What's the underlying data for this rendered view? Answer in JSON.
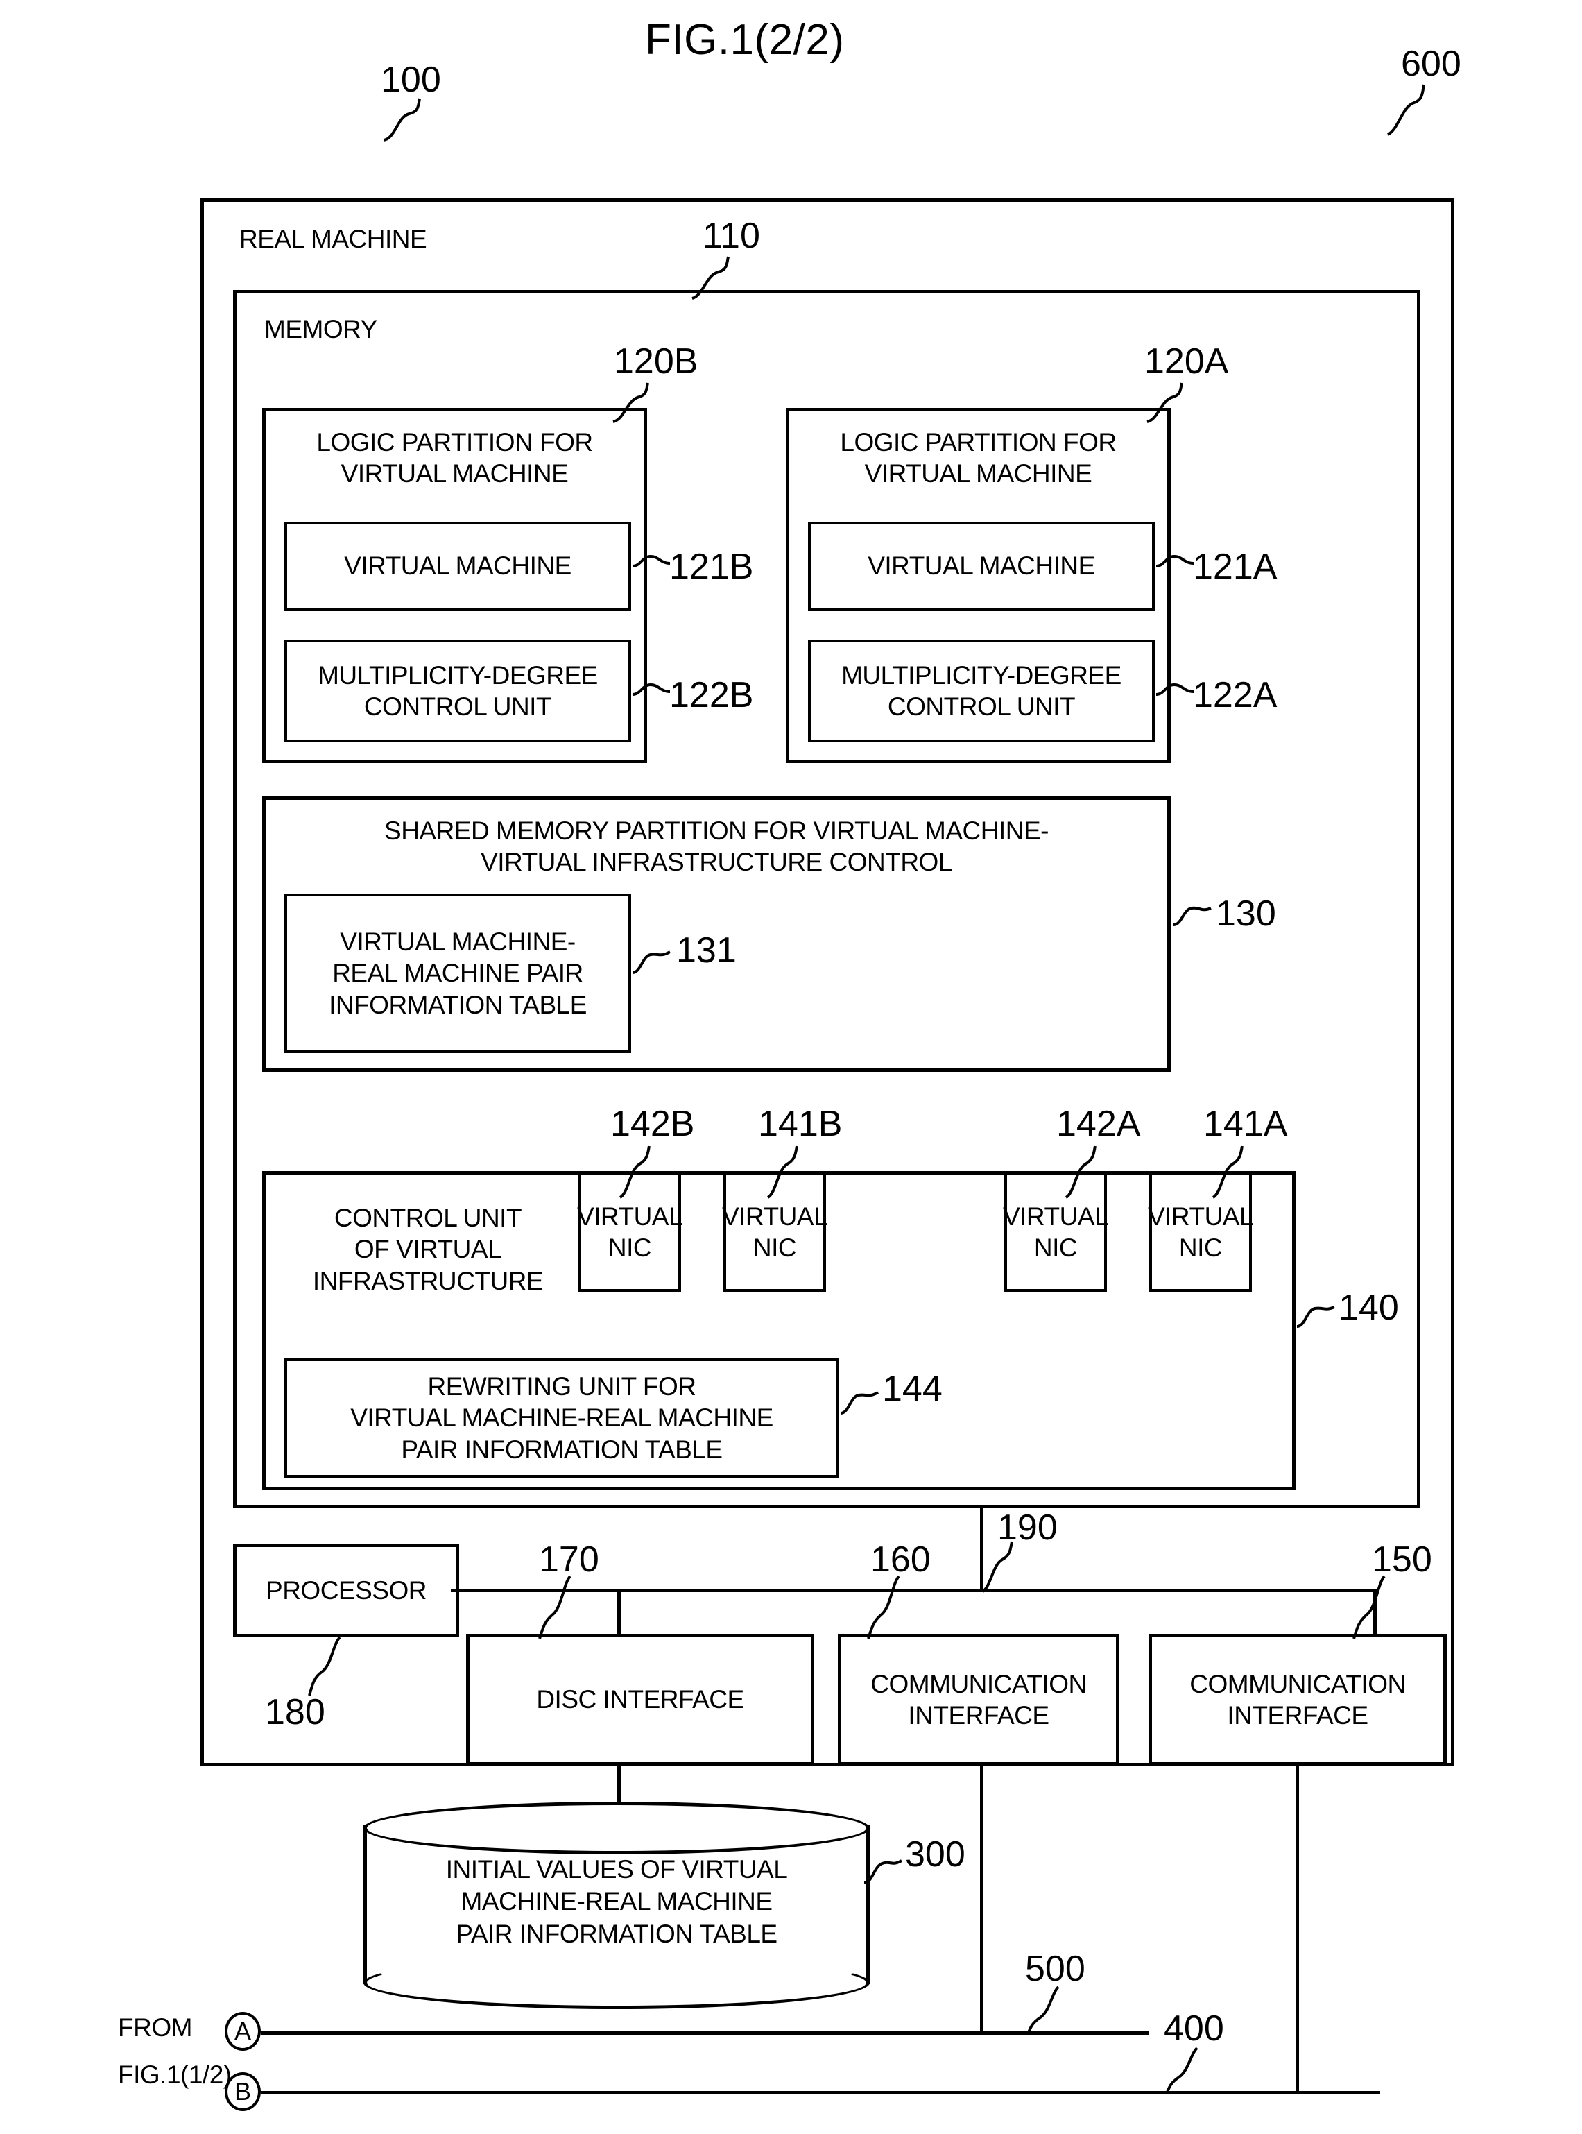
{
  "figure": {
    "title": "FIG.1(2/2)"
  },
  "outer": {
    "label": "REAL MACHINE",
    "ref_real_machine": "100",
    "ref_system": "600"
  },
  "memory": {
    "label": "MEMORY",
    "ref": "110"
  },
  "partitions": [
    {
      "ref": "120B",
      "title_line1": "LOGIC PARTITION FOR",
      "title_line2": "VIRTUAL MACHINE",
      "vm_label": "VIRTUAL MACHINE",
      "vm_ref": "121B",
      "mdcu_line1": "MULTIPLICITY-DEGREE",
      "mdcu_line2": "CONTROL UNIT",
      "mdcu_ref": "122B"
    },
    {
      "ref": "120A",
      "title_line1": "LOGIC PARTITION FOR",
      "title_line2": "VIRTUAL MACHINE",
      "vm_label": "VIRTUAL MACHINE",
      "vm_ref": "121A",
      "mdcu_line1": "MULTIPLICITY-DEGREE",
      "mdcu_line2": "CONTROL UNIT",
      "mdcu_ref": "122A"
    }
  ],
  "shared_memory": {
    "title_line1": "SHARED MEMORY PARTITION FOR VIRTUAL MACHINE-",
    "title_line2": "VIRTUAL INFRASTRUCTURE CONTROL",
    "ref": "130",
    "table_line1": "VIRTUAL MACHINE-",
    "table_line2": "REAL MACHINE PAIR",
    "table_line3": "INFORMATION TABLE",
    "table_ref": "131"
  },
  "infrastructure": {
    "ref": "140",
    "control_line1": "CONTROL UNIT",
    "control_line2": "OF VIRTUAL",
    "control_line3": "INFRASTRUCTURE",
    "nics": [
      {
        "ref": "142B",
        "line1": "VIRTUAL",
        "line2": "NIC"
      },
      {
        "ref": "141B",
        "line1": "VIRTUAL",
        "line2": "NIC"
      },
      {
        "ref": "142A",
        "line1": "VIRTUAL",
        "line2": "NIC"
      },
      {
        "ref": "141A",
        "line1": "VIRTUAL",
        "line2": "NIC"
      }
    ],
    "rewriting_line1": "REWRITING UNIT FOR",
    "rewriting_line2": "VIRTUAL MACHINE-REAL MACHINE",
    "rewriting_line3": "PAIR INFORMATION TABLE",
    "rewriting_ref": "144"
  },
  "hardware": {
    "processor_label": "PROCESSOR",
    "processor_ref": "180",
    "disc_interface_label": "DISC INTERFACE",
    "disc_interface_ref": "170",
    "comm_interface_1_line1": "COMMUNICATION",
    "comm_interface_1_line2": "INTERFACE",
    "comm_interface_1_ref": "160",
    "comm_interface_2_line1": "COMMUNICATION",
    "comm_interface_2_line2": "INTERFACE",
    "comm_interface_2_ref": "150",
    "bus_ref": "190"
  },
  "storage": {
    "line1": "INITIAL VALUES OF VIRTUAL",
    "line2": "MACHINE-REAL MACHINE",
    "line3": "PAIR INFORMATION TABLE",
    "ref": "300"
  },
  "connectors": {
    "from_label_line1": "FROM",
    "from_label_line2": "FIG.1(1/2)",
    "circle_a": "A",
    "circle_b": "B",
    "net_500_ref": "500",
    "net_400_ref": "400"
  }
}
